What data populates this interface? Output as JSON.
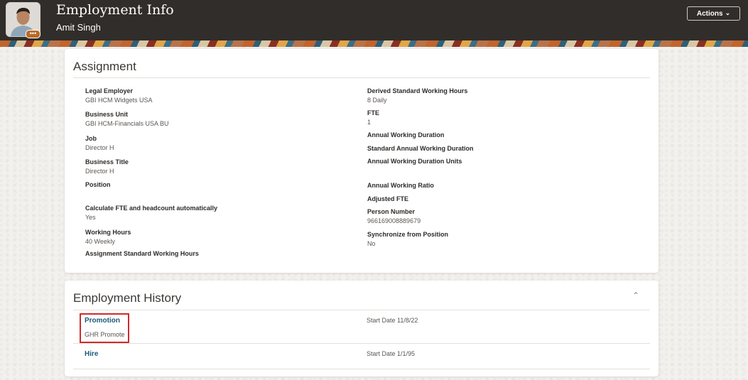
{
  "header": {
    "title": "Employment Info",
    "person_name": "Amit Singh",
    "avatar_badge": "•••",
    "actions_label": "Actions"
  },
  "assignment": {
    "title": "Assignment",
    "left_fields": [
      {
        "label": "Legal Employer",
        "value": "GBI HCM Widgets USA"
      },
      {
        "label": "Business Unit",
        "value": "GBI HCM-Financials USA BU"
      },
      {
        "label": "Job",
        "value": "Director H"
      },
      {
        "label": "Business Title",
        "value": "Director H"
      },
      {
        "label": "Position",
        "value": ""
      },
      {
        "label": "Calculate FTE and headcount automatically",
        "value": "Yes"
      },
      {
        "label": "Working Hours",
        "value": "40 Weekly"
      },
      {
        "label": "Assignment Standard Working Hours",
        "value": ""
      }
    ],
    "right_fields": [
      {
        "label": "Derived Standard Working Hours",
        "value": "8 Daily"
      },
      {
        "label": "FTE",
        "value": "1"
      },
      {
        "label": "Annual Working Duration",
        "value": ""
      },
      {
        "label": "Standard Annual Working Duration",
        "value": ""
      },
      {
        "label": "Annual Working Duration Units",
        "value": ""
      },
      {
        "label": "Annual Working Ratio",
        "value": ""
      },
      {
        "label": "Adjusted FTE",
        "value": ""
      },
      {
        "label": "Person Number",
        "value": "966169008889679"
      },
      {
        "label": "Synchronize from Position",
        "value": "No"
      }
    ]
  },
  "history": {
    "title": "Employment History",
    "items": [
      {
        "action": "Promotion",
        "reason": "GHR Promote",
        "date": "Start Date 11/8/22"
      },
      {
        "action": "Hire",
        "reason": "",
        "date": "Start Date 1/1/95"
      }
    ]
  }
}
